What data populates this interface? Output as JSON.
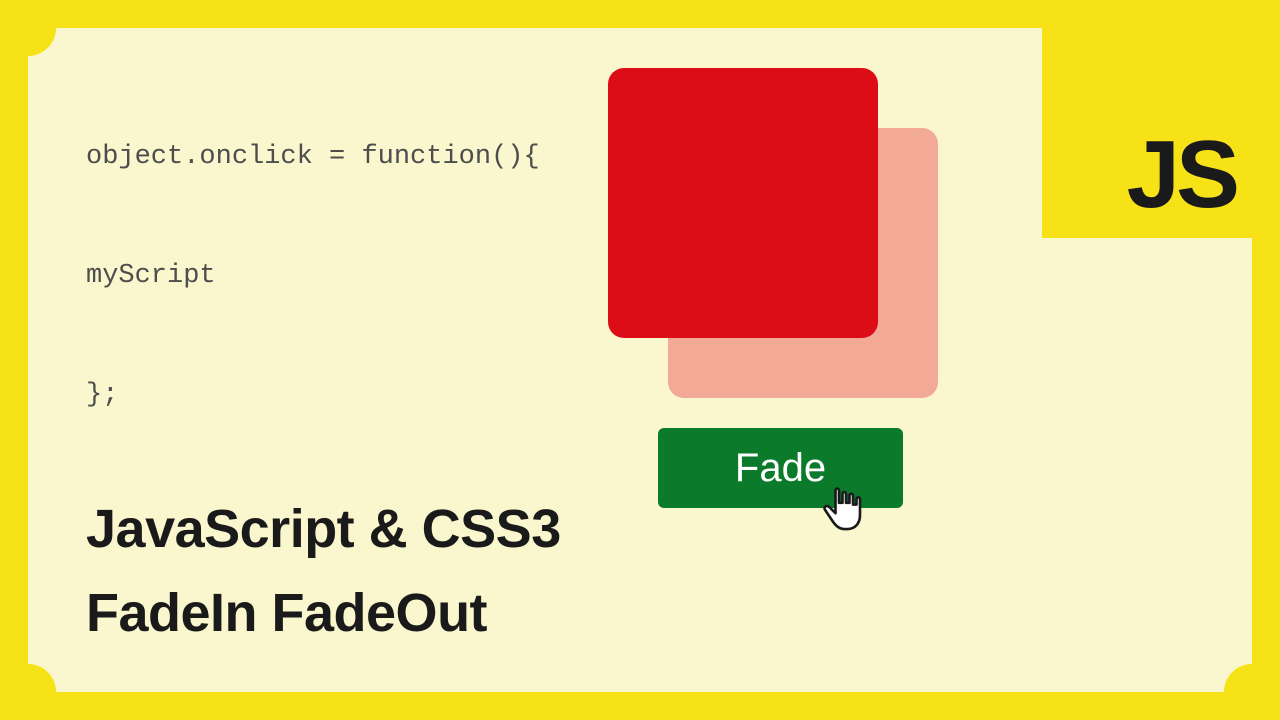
{
  "code": {
    "line1": "object.onclick = function(){",
    "line2": "myScript",
    "line3": "};"
  },
  "title": {
    "line1": "JavaScript & CSS3",
    "line2": "FadeIn FadeOut"
  },
  "button": {
    "label": "Fade"
  },
  "badge": {
    "text": "JS"
  },
  "colors": {
    "bg": "#f7e217",
    "card": "#faf6ce",
    "square_front": "#dd0d18",
    "square_back": "#f2a996",
    "btn": "#0b7a2b"
  }
}
